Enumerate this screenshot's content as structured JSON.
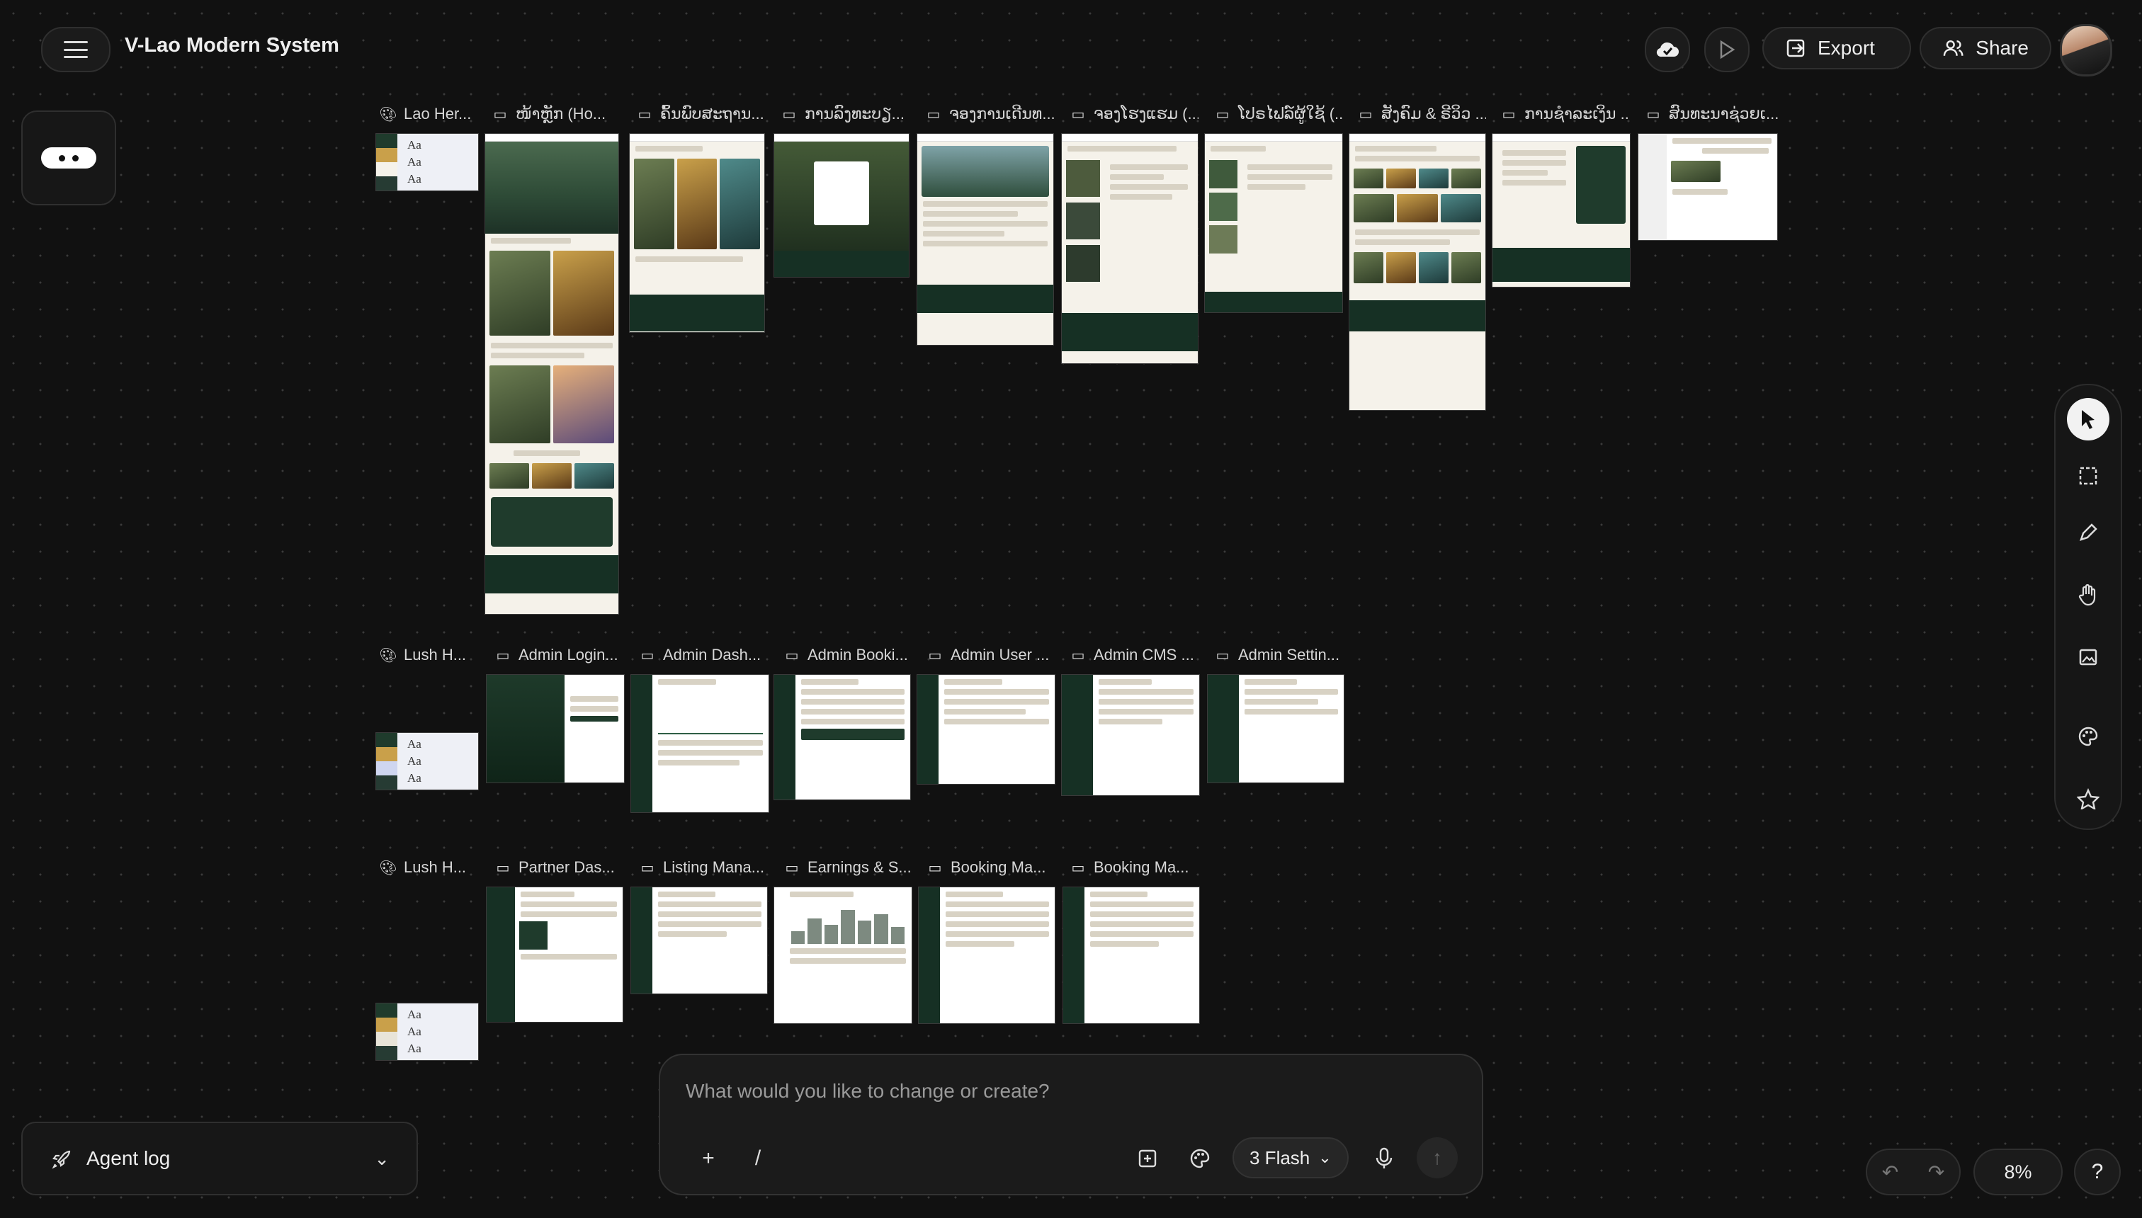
{
  "app": {
    "title": "V-Lao Modern System"
  },
  "header": {
    "export_label": "Export",
    "share_label": "Share",
    "icons": [
      "cloud-check-icon",
      "play-icon",
      "export-icon",
      "share-users-icon"
    ]
  },
  "canvas": {
    "row1": [
      {
        "label": "Lao Her...",
        "icon": "palette-icon"
      },
      {
        "label": "ໜ້າຫຼັກ (Ho...",
        "icon": "screen-icon"
      },
      {
        "label": "ຄົ້ນພົບສະຖານ...",
        "icon": "screen-icon"
      },
      {
        "label": "ການລົງທະບຽ...",
        "icon": "screen-icon"
      },
      {
        "label": "ຈອງການເດີນທ...",
        "icon": "screen-icon"
      },
      {
        "label": "ຈອງໂຮງແຮມ (...",
        "icon": "screen-icon"
      },
      {
        "label": "ໂປຣໄຟລ໌ຜູ້ໃຊ້ (...",
        "icon": "screen-icon"
      },
      {
        "label": "ສັງຄົມ & ຣີວິວ ...",
        "icon": "screen-icon"
      },
      {
        "label": "ການຊໍາລະເງິນ ...",
        "icon": "screen-icon"
      },
      {
        "label": "ສົນທະນາຊ່ວຍເ...",
        "icon": "screen-icon"
      }
    ],
    "row2": [
      {
        "label": "Lush H...",
        "icon": "palette-icon"
      },
      {
        "label": "Admin Login...",
        "icon": "screen-icon"
      },
      {
        "label": "Admin Dash...",
        "icon": "screen-icon"
      },
      {
        "label": "Admin Booki...",
        "icon": "screen-icon"
      },
      {
        "label": "Admin User ...",
        "icon": "screen-icon"
      },
      {
        "label": "Admin CMS ...",
        "icon": "screen-icon"
      },
      {
        "label": "Admin Settin...",
        "icon": "screen-icon"
      }
    ],
    "row3": [
      {
        "label": "Lush H...",
        "icon": "palette-icon"
      },
      {
        "label": "Partner Das...",
        "icon": "screen-icon"
      },
      {
        "label": "Listing Mana...",
        "icon": "screen-icon"
      },
      {
        "label": "Earnings & S...",
        "icon": "screen-icon"
      },
      {
        "label": "Booking Ma...",
        "icon": "screen-icon"
      },
      {
        "label": "Booking Ma...",
        "icon": "screen-icon"
      }
    ],
    "design_system_sample": "Aa"
  },
  "tools": [
    "cursor-icon",
    "select-area-icon",
    "pencil-icon",
    "hand-icon",
    "image-icon",
    "palette-icon",
    "star-icon"
  ],
  "composer": {
    "placeholder": "What would you like to change or create?",
    "slash_label": "/",
    "model_label": "3 Flash"
  },
  "agent_log": {
    "label": "Agent log"
  },
  "zoom": {
    "value": "8%"
  },
  "help": {
    "label": "?"
  }
}
